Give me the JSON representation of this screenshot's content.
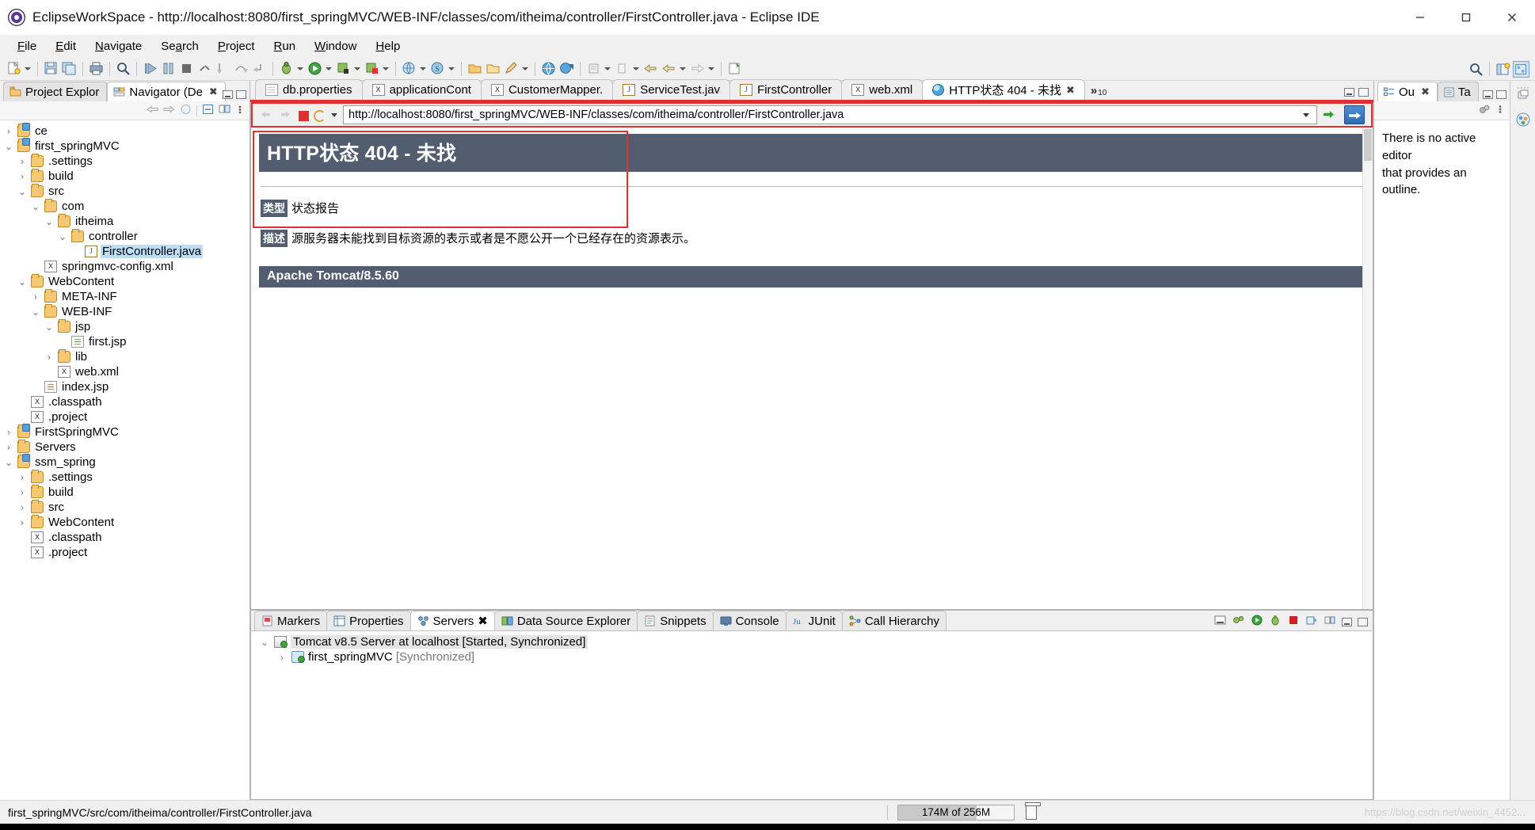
{
  "window": {
    "title": "EclipseWorkSpace - http://localhost:8080/first_springMVC/WEB-INF/classes/com/itheima/controller/FirstController.java - Eclipse IDE",
    "minimize_label": "—",
    "maximize_label": "□",
    "close_label": "✕"
  },
  "menubar": {
    "items": [
      "File",
      "Edit",
      "Navigate",
      "Search",
      "Project",
      "Run",
      "Window",
      "Help"
    ]
  },
  "left_panel": {
    "tabs": [
      {
        "label": "Project Explor",
        "active": false,
        "icon": "project-explorer-icon"
      },
      {
        "label": "Navigator (De",
        "active": true,
        "icon": "navigator-icon",
        "closable": true
      }
    ],
    "tree": [
      {
        "label": "ce",
        "depth": 0,
        "twisty": "collapsed",
        "icon": "project"
      },
      {
        "label": "first_springMVC",
        "depth": 0,
        "twisty": "expanded",
        "icon": "project"
      },
      {
        "label": ".settings",
        "depth": 1,
        "twisty": "collapsed",
        "icon": "folder"
      },
      {
        "label": "build",
        "depth": 1,
        "twisty": "collapsed",
        "icon": "folder"
      },
      {
        "label": "src",
        "depth": 1,
        "twisty": "expanded",
        "icon": "folder"
      },
      {
        "label": "com",
        "depth": 2,
        "twisty": "expanded",
        "icon": "folder"
      },
      {
        "label": "itheima",
        "depth": 3,
        "twisty": "expanded",
        "icon": "folder"
      },
      {
        "label": "controller",
        "depth": 4,
        "twisty": "expanded",
        "icon": "folder"
      },
      {
        "label": "FirstController.java",
        "depth": 5,
        "twisty": "none",
        "icon": "java",
        "selected": true
      },
      {
        "label": "springmvc-config.xml",
        "depth": 2,
        "twisty": "none",
        "icon": "xml"
      },
      {
        "label": "WebContent",
        "depth": 1,
        "twisty": "expanded",
        "icon": "folder"
      },
      {
        "label": "META-INF",
        "depth": 2,
        "twisty": "collapsed",
        "icon": "folder"
      },
      {
        "label": "WEB-INF",
        "depth": 2,
        "twisty": "expanded",
        "icon": "folder"
      },
      {
        "label": "jsp",
        "depth": 3,
        "twisty": "expanded",
        "icon": "folder"
      },
      {
        "label": "first.jsp",
        "depth": 4,
        "twisty": "none",
        "icon": "jsp"
      },
      {
        "label": "lib",
        "depth": 3,
        "twisty": "collapsed",
        "icon": "folder"
      },
      {
        "label": "web.xml",
        "depth": 3,
        "twisty": "none",
        "icon": "xml"
      },
      {
        "label": "index.jsp",
        "depth": 2,
        "twisty": "none",
        "icon": "jsp"
      },
      {
        "label": ".classpath",
        "depth": 1,
        "twisty": "none",
        "icon": "xml"
      },
      {
        "label": ".project",
        "depth": 1,
        "twisty": "none",
        "icon": "xml"
      },
      {
        "label": "FirstSpringMVC",
        "depth": 0,
        "twisty": "collapsed",
        "icon": "project"
      },
      {
        "label": "Servers",
        "depth": 0,
        "twisty": "collapsed",
        "icon": "folder"
      },
      {
        "label": "ssm_spring",
        "depth": 0,
        "twisty": "expanded",
        "icon": "project"
      },
      {
        "label": ".settings",
        "depth": 1,
        "twisty": "collapsed",
        "icon": "folder"
      },
      {
        "label": "build",
        "depth": 1,
        "twisty": "collapsed",
        "icon": "folder"
      },
      {
        "label": "src",
        "depth": 1,
        "twisty": "collapsed",
        "icon": "folder"
      },
      {
        "label": "WebContent",
        "depth": 1,
        "twisty": "collapsed",
        "icon": "folder"
      },
      {
        "label": ".classpath",
        "depth": 1,
        "twisty": "none",
        "icon": "xml"
      },
      {
        "label": ".project",
        "depth": 1,
        "twisty": "none",
        "icon": "xml"
      }
    ]
  },
  "editor": {
    "tabs": [
      {
        "label": "db.properties",
        "icon": "properties-file-icon",
        "active": false
      },
      {
        "label": "applicationCont",
        "icon": "xml-file-icon",
        "active": false
      },
      {
        "label": "CustomerMapper.",
        "icon": "xml-file-icon",
        "active": false
      },
      {
        "label": "ServiceTest.jav",
        "icon": "java-file-icon",
        "active": false
      },
      {
        "label": "FirstController",
        "icon": "java-file-icon",
        "active": false
      },
      {
        "label": "web.xml",
        "icon": "xml-file-icon",
        "active": false
      },
      {
        "label": "HTTP状态 404 - 未找",
        "icon": "globe-icon",
        "active": true,
        "closable": true
      }
    ],
    "more_tabs_count": "10",
    "more_tabs_symbol": "»"
  },
  "browser": {
    "url": "http://localhost:8080/first_springMVC/WEB-INF/classes/com/itheima/controller/FirstController.java",
    "back_label": "Back",
    "forward_label": "Forward",
    "stop_label": "Stop",
    "refresh_label": "Refresh",
    "go_label": "Go"
  },
  "error_page": {
    "heading": "HTTP状态 404 - 未找",
    "type_key": "类型",
    "type_value": "状态报告",
    "desc_key": "描述",
    "desc_value": "源服务器未能找到目标资源的表示或者是不愿公开一个已经存在的资源表示。",
    "server_version": "Apache Tomcat/8.5.60",
    "accent_color": "#525d6f",
    "highlight_color": "#e03131"
  },
  "bottom_panel": {
    "tabs": [
      {
        "label": "Markers",
        "icon": "markers-icon",
        "active": false
      },
      {
        "label": "Properties",
        "icon": "properties-icon",
        "active": false
      },
      {
        "label": "Servers",
        "icon": "servers-icon",
        "active": true,
        "closable": true
      },
      {
        "label": "Data Source Explorer",
        "icon": "data-source-icon",
        "active": false
      },
      {
        "label": "Snippets",
        "icon": "snippets-icon",
        "active": false
      },
      {
        "label": "Console",
        "icon": "console-icon",
        "active": false
      },
      {
        "label": "JUnit",
        "icon": "junit-icon",
        "active": false
      },
      {
        "label": "Call Hierarchy",
        "icon": "call-hierarchy-icon",
        "active": false
      }
    ],
    "rows": [
      {
        "label": "Tomcat v8.5 Server at localhost",
        "status": "[Started, Synchronized]",
        "depth": 0,
        "twisty": "expanded",
        "selected": true
      },
      {
        "label": "first_springMVC",
        "status": "[Synchronized]",
        "depth": 1,
        "twisty": "collapsed",
        "selected": false
      }
    ]
  },
  "right_panel": {
    "tabs": [
      {
        "label": "Ou",
        "active": true,
        "closable": true,
        "icon": "outline-icon"
      },
      {
        "label": "Ta",
        "active": false,
        "icon": "task-list-icon"
      }
    ],
    "empty_message_line1": "There is no active editor",
    "empty_message_line2": "that provides an outline."
  },
  "statusbar": {
    "path": "first_springMVC/src/com/itheima/controller/FirstController.java",
    "memory": "174M of 256M",
    "memory_used_pct": 68,
    "trash_label": "Run garbage collector",
    "watermark": "https://blog.csdn.net/weixin_4452..."
  }
}
